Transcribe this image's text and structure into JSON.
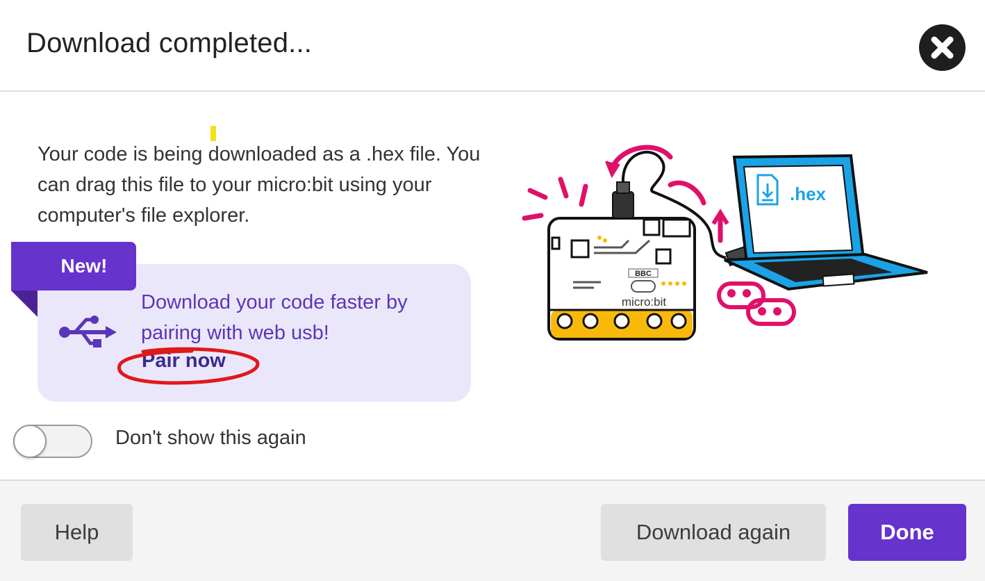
{
  "dialog": {
    "title": "Download completed...",
    "close_icon": "close-icon"
  },
  "body": {
    "message": "Your code is being downloaded as a .hex file. You can drag this file to your micro:bit using your computer's file explorer."
  },
  "promo": {
    "badge": "New!",
    "text": "Download your code faster by pairing with web usb!",
    "link": "Pair now",
    "icon": "usb-icon",
    "colors": {
      "background": "#ebe7fb",
      "badge": "#6633cc",
      "text": "#5a36b8"
    }
  },
  "toggle": {
    "label": "Don't show this again",
    "on": false
  },
  "illustration": {
    "board_bbc": "BBC",
    "board_label": "micro:bit",
    "laptop_file": ".hex"
  },
  "footer": {
    "help": "Help",
    "download_again": "Download again",
    "done": "Done"
  },
  "colors": {
    "accent": "#6633cc",
    "annotation": "#e01919",
    "magenta": "#e0106a",
    "laptop_screen": "#1aa3e6",
    "board_edge": "#f8b90a"
  }
}
